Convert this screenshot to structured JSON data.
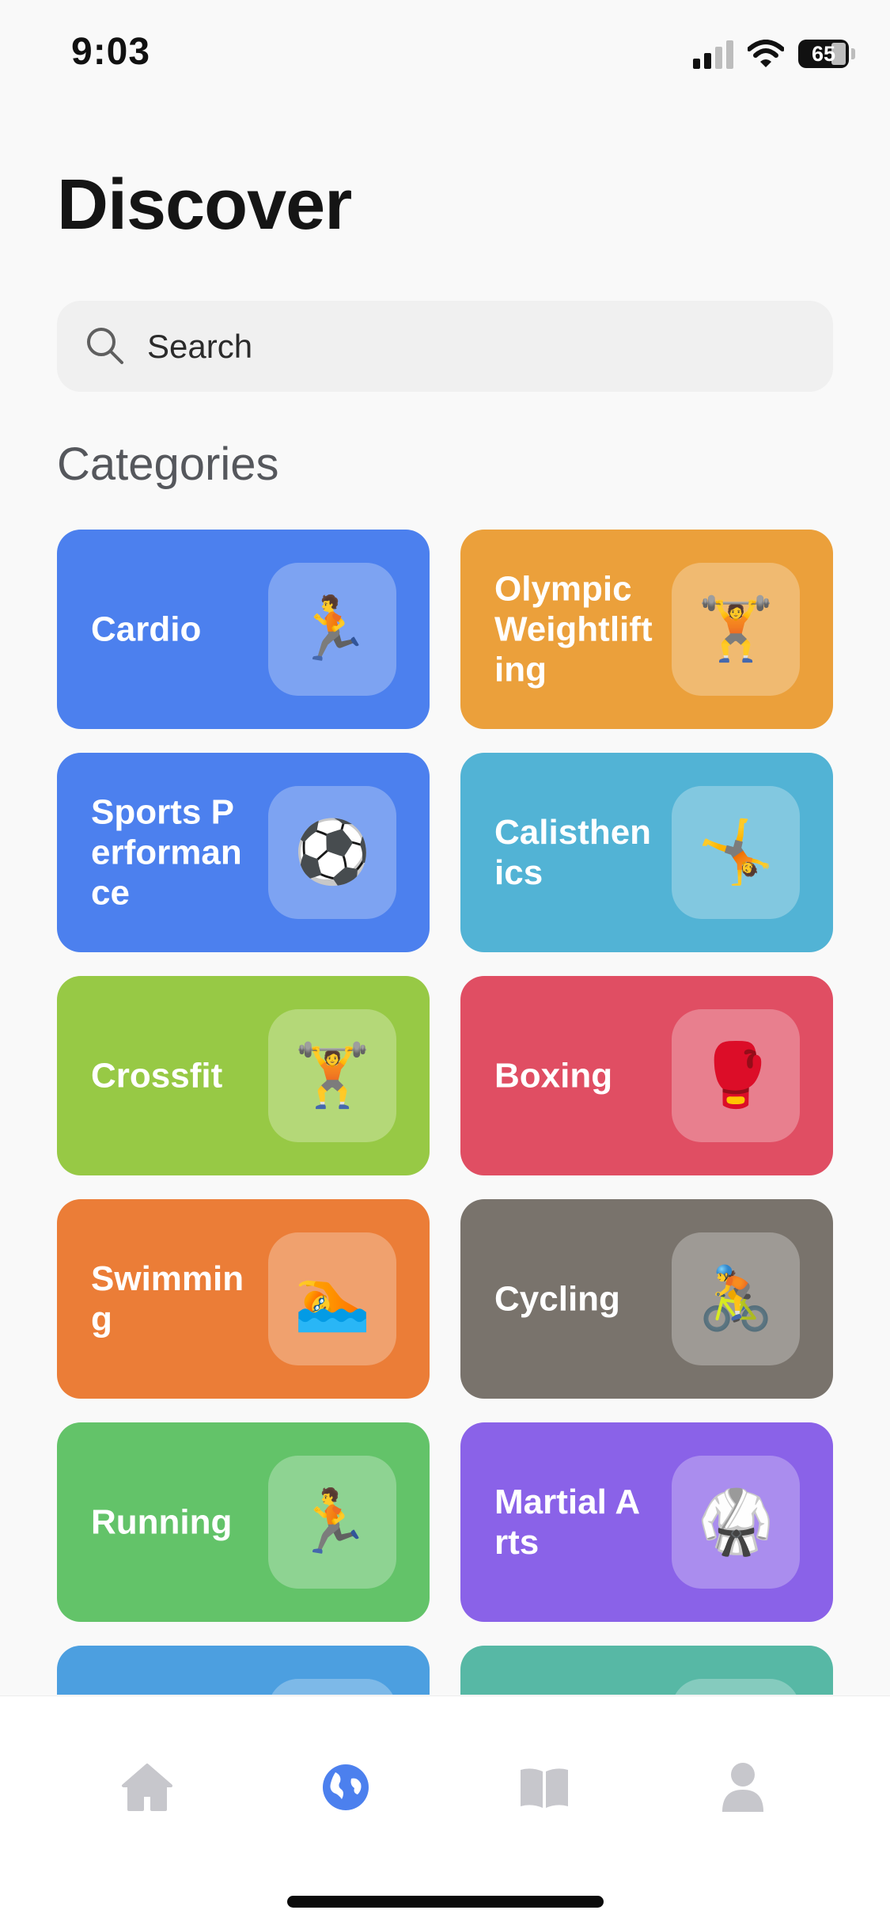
{
  "status": {
    "time": "9:03",
    "battery": "65"
  },
  "page": {
    "title": "Discover"
  },
  "search": {
    "placeholder": "Search"
  },
  "categories_title": "Categories",
  "categories": [
    {
      "label": "Cardio",
      "emoji": "🏃",
      "icon_name": "runner-icon",
      "color": "#4C80EE"
    },
    {
      "label": "Olympic Weightlifting",
      "emoji": "🏋",
      "icon_name": "weightlifter-icon",
      "color": "#EBA03B"
    },
    {
      "label": "Sports Performance",
      "emoji": "⚽",
      "icon_name": "soccer-ball-icon",
      "color": "#4C80EE"
    },
    {
      "label": "Calisthenics",
      "emoji": "🤸",
      "icon_name": "cartwheel-icon",
      "color": "#52B3D5"
    },
    {
      "label": "Crossfit",
      "emoji": "🏋",
      "icon_name": "weightlifter-icon",
      "color": "#97C945"
    },
    {
      "label": "Boxing",
      "emoji": "🥊",
      "icon_name": "boxing-glove-icon",
      "color": "#E04E63"
    },
    {
      "label": "Swimming",
      "emoji": "🏊",
      "icon_name": "swimmer-icon",
      "color": "#EB7D37"
    },
    {
      "label": "Cycling",
      "emoji": "🚴",
      "icon_name": "cyclist-icon",
      "color": "#79736C"
    },
    {
      "label": "Running",
      "emoji": "🏃",
      "icon_name": "runner-icon",
      "color": "#63C369"
    },
    {
      "label": "Martial Arts",
      "emoji": "🥋",
      "icon_name": "martial-arts-uniform-icon",
      "color": "#8A62E8"
    },
    {
      "label": "",
      "emoji": "",
      "icon_name": "",
      "color": "#4C9FE0"
    },
    {
      "label": "",
      "emoji": "",
      "icon_name": "",
      "color": "#57B8A5"
    }
  ],
  "tabs": [
    {
      "name": "home",
      "icon": "home-icon",
      "active": false
    },
    {
      "name": "discover",
      "icon": "globe-icon",
      "active": true
    },
    {
      "name": "library",
      "icon": "book-icon",
      "active": false
    },
    {
      "name": "profile",
      "icon": "person-icon",
      "active": false
    }
  ],
  "colors": {
    "active_tab": "#4C80EE",
    "inactive_tab": "#C7C7CC"
  }
}
